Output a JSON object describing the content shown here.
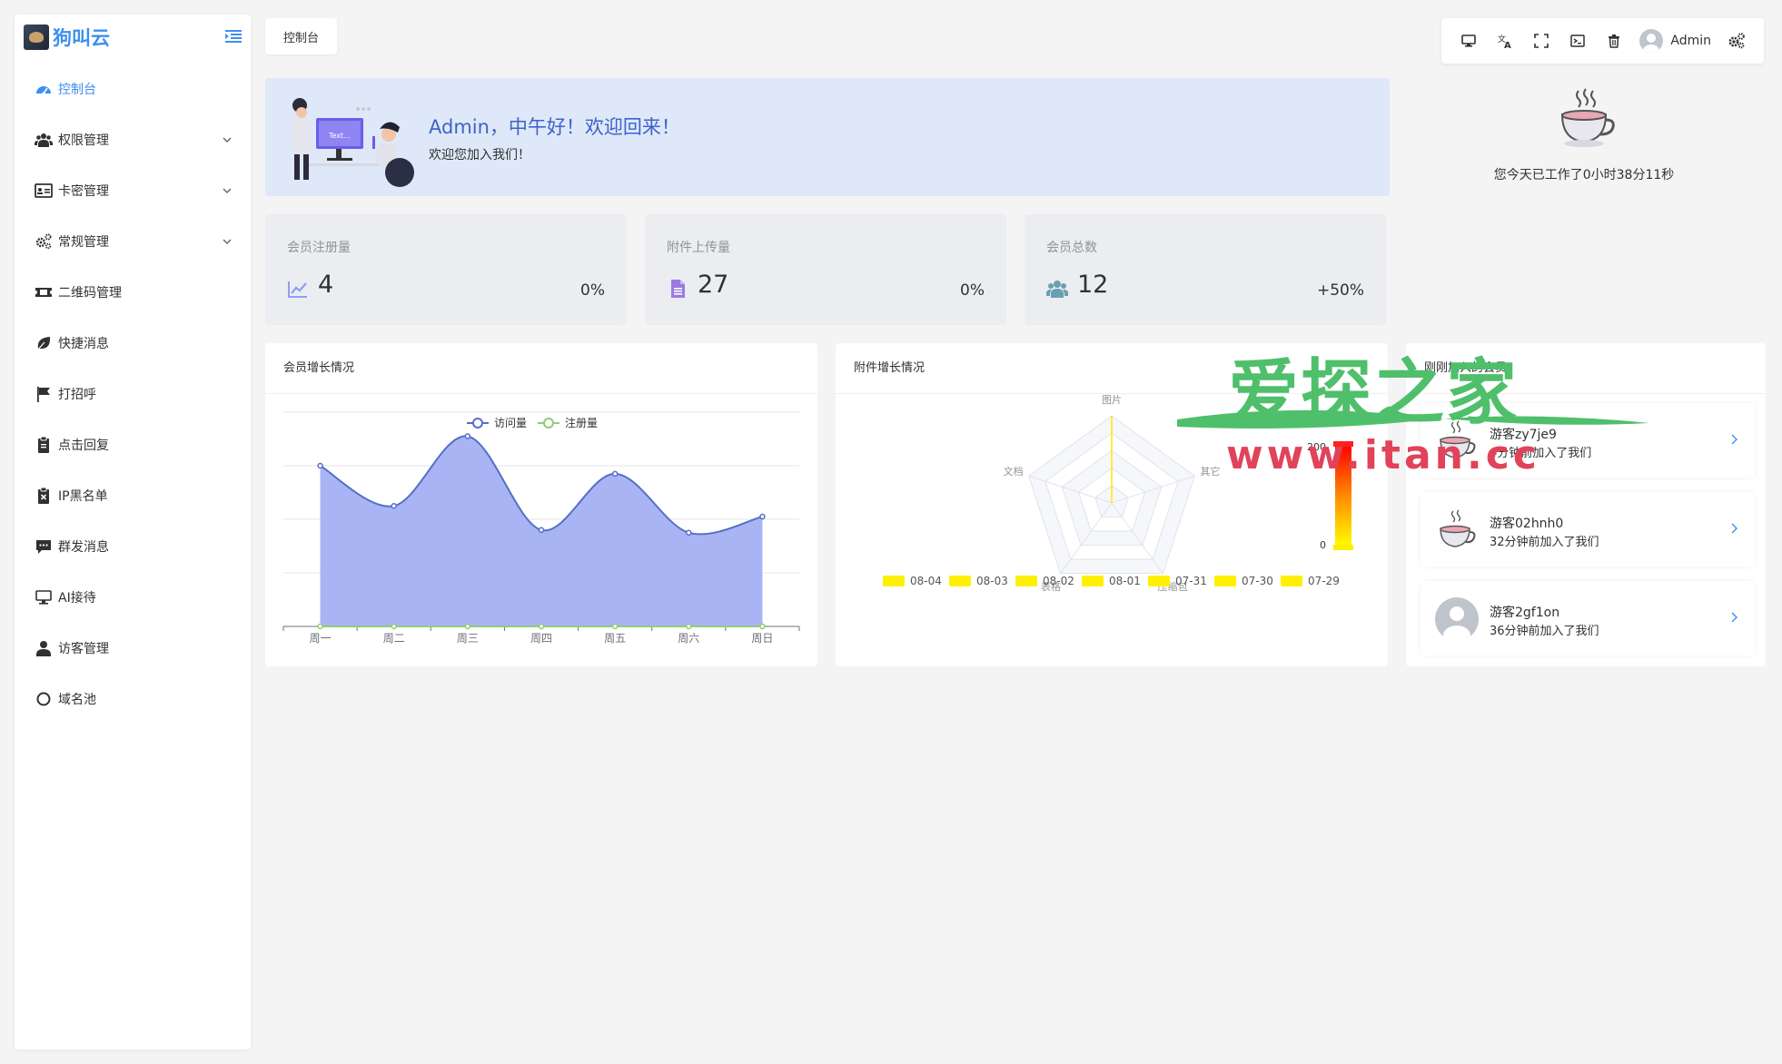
{
  "brand": {
    "name": "狗叫云"
  },
  "sidebar": {
    "items": [
      {
        "label": "控制台",
        "icon": "dashboard-icon",
        "active": true,
        "expandable": false
      },
      {
        "label": "权限管理",
        "icon": "users-icon",
        "active": false,
        "expandable": true
      },
      {
        "label": "卡密管理",
        "icon": "id-card-icon",
        "active": false,
        "expandable": true
      },
      {
        "label": "常规管理",
        "icon": "cogs-icon",
        "active": false,
        "expandable": true
      },
      {
        "label": "二维码管理",
        "icon": "ticket-icon",
        "active": false,
        "expandable": false
      },
      {
        "label": "快捷消息",
        "icon": "leaf-icon",
        "active": false,
        "expandable": false
      },
      {
        "label": "打招呼",
        "icon": "flag-icon",
        "active": false,
        "expandable": false
      },
      {
        "label": "点击回复",
        "icon": "clipboard-icon",
        "active": false,
        "expandable": false
      },
      {
        "label": "IP黑名单",
        "icon": "ban-list-icon",
        "active": false,
        "expandable": false
      },
      {
        "label": "群发消息",
        "icon": "message-icon",
        "active": false,
        "expandable": false
      },
      {
        "label": "AI接待",
        "icon": "monitor-icon",
        "active": false,
        "expandable": false
      },
      {
        "label": "访客管理",
        "icon": "user-icon",
        "active": false,
        "expandable": false
      },
      {
        "label": "域名池",
        "icon": "circle-icon",
        "active": false,
        "expandable": false
      }
    ]
  },
  "tabs": [
    {
      "label": "控制台"
    }
  ],
  "toolbar": {
    "buttons": [
      "desktop-icon",
      "translate-icon",
      "fullscreen-icon",
      "terminal-icon",
      "trash-icon"
    ],
    "username": "Admin",
    "settings_icon": "settings-icon"
  },
  "welcome": {
    "title": "Admin，中午好！欢迎回来！",
    "subtitle": "欢迎您加入我们！",
    "illustration_text": "Text..."
  },
  "worktime": {
    "text": "您今天已工作了0小时38分11秒"
  },
  "stats": [
    {
      "label": "会员注册量",
      "value": "4",
      "change": "0%",
      "icon": "line-chart-icon",
      "color": "#8e9ef5"
    },
    {
      "label": "附件上传量",
      "value": "27",
      "change": "0%",
      "icon": "file-icon",
      "color": "#9b7be0"
    },
    {
      "label": "会员总数",
      "value": "12",
      "change": "+50%",
      "icon": "users-icon",
      "color": "#6a9fb2"
    }
  ],
  "panels": {
    "member_growth": {
      "title": "会员增长情况"
    },
    "attachment_growth": {
      "title": "附件增长情况"
    },
    "new_members": {
      "title": "刚刚加入的会员"
    }
  },
  "chart_data": [
    {
      "type": "area",
      "title": "会员增长情况",
      "categories": [
        "周一",
        "周二",
        "周三",
        "周四",
        "周五",
        "周六",
        "周日"
      ],
      "series": [
        {
          "name": "访问量",
          "values": [
            300,
            225,
            355,
            180,
            285,
            175,
            205
          ],
          "color": "#5470c6",
          "fill": "#a3b0f3"
        },
        {
          "name": "注册量",
          "values": [
            0,
            0,
            0,
            0,
            0,
            0,
            0
          ],
          "color": "#91cc75"
        }
      ],
      "ylim": [
        0,
        400
      ],
      "legend": "top-center",
      "grid": true
    },
    {
      "type": "radar",
      "title": "附件增长情况",
      "indicators": [
        "图片",
        "其它",
        "压缩包",
        "表格",
        "文档"
      ],
      "series": [
        {
          "name": "08-04",
          "values": [
            0,
            0,
            0,
            0,
            0
          ]
        },
        {
          "name": "08-03",
          "values": [
            0,
            0,
            0,
            0,
            0
          ]
        },
        {
          "name": "08-02",
          "values": [
            0,
            0,
            0,
            0,
            0
          ]
        },
        {
          "name": "08-01",
          "values": [
            0,
            0,
            0,
            0,
            0
          ]
        },
        {
          "name": "07-31",
          "values": [
            0,
            0,
            0,
            0,
            0
          ]
        },
        {
          "name": "07-30",
          "values": [
            0,
            0,
            0,
            0,
            0
          ]
        },
        {
          "name": "07-29",
          "values": [
            0,
            0,
            0,
            0,
            0
          ]
        }
      ],
      "highlight_series": "08-04",
      "highlight_values": [
        200,
        0,
        0,
        0,
        0
      ],
      "visual_map": {
        "min": 0,
        "max": 200,
        "min_label": "0",
        "max_label": "200"
      },
      "legend": "bottom"
    }
  ],
  "members": [
    {
      "name": "游客zy7je9",
      "time": "4分钟前加入了我们",
      "avatar": "teacup-avatar"
    },
    {
      "name": "游客02hnh0",
      "time": "32分钟前加入了我们",
      "avatar": "teacup-avatar"
    },
    {
      "name": "游客2gf1on",
      "time": "36分钟前加入了我们",
      "avatar": "default-avatar"
    }
  ],
  "watermark": {
    "text": "爱探之家",
    "url": "www.itan.cc"
  }
}
